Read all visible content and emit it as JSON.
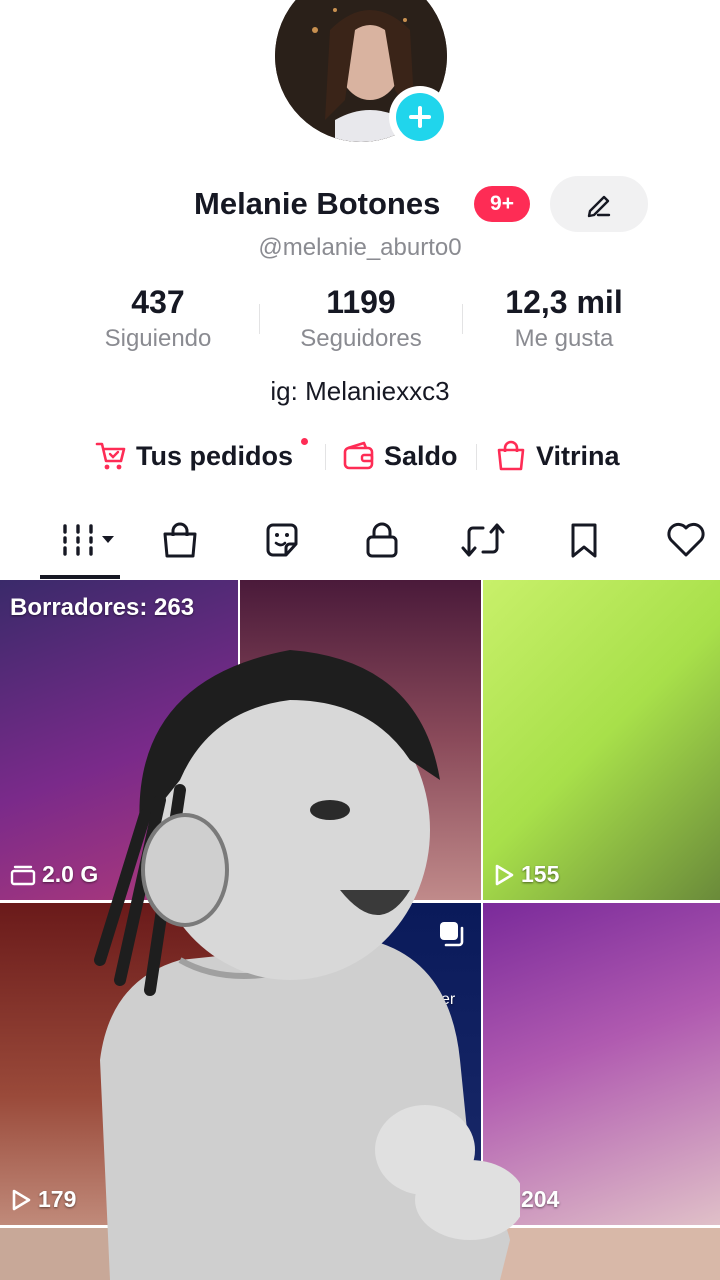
{
  "profile": {
    "name": "Melanie Botones",
    "badge": "9+",
    "handle": "@melanie_aburto0",
    "bio": "ig: Melaniexxc3"
  },
  "stats": [
    {
      "value": "437",
      "label": "Siguiendo"
    },
    {
      "value": "1199",
      "label": "Seguidores"
    },
    {
      "value": "12,3 mil",
      "label": "Me gusta"
    }
  ],
  "quick_links": [
    {
      "label": "Tus pedidos",
      "icon": "cart-icon"
    },
    {
      "label": "Saldo",
      "icon": "wallet-icon"
    },
    {
      "label": "Vitrina",
      "icon": "shopping-bag-icon"
    }
  ],
  "tabs": [
    {
      "icon": "grid-dropdown-icon",
      "active": true
    },
    {
      "icon": "shopping-bag-icon"
    },
    {
      "icon": "sticker-icon"
    },
    {
      "icon": "lock-icon"
    },
    {
      "icon": "repost-icon"
    },
    {
      "icon": "bookmark-icon"
    },
    {
      "icon": "heart-icon"
    }
  ],
  "grid": {
    "drafts_label": "Borradores: 263",
    "drafts_views": "2.0 G",
    "items": [
      {
        "views": "155"
      },
      {
        "views": "179"
      },
      {
        "caption": "ser"
      },
      {
        "views": "204"
      }
    ]
  },
  "colors": {
    "accent": "#fe2c55",
    "plus_badge": "#20d5ec",
    "text": "#161823",
    "muted": "#8a8b91"
  }
}
